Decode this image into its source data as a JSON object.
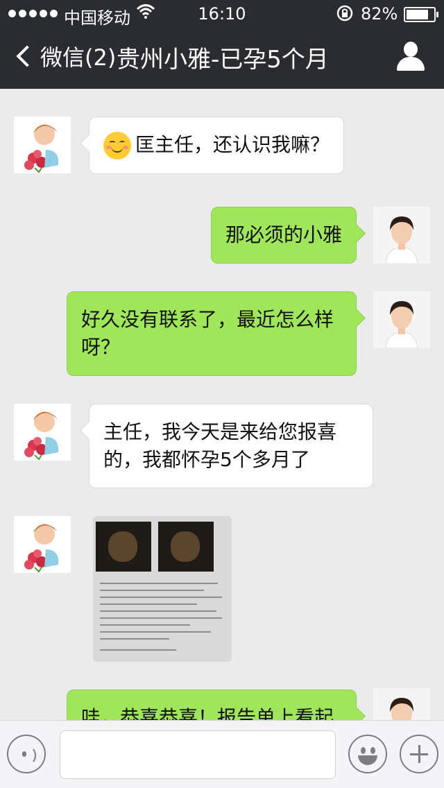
{
  "status_bar": {
    "carrier": "中国移动",
    "time": "16:10",
    "battery": "82%",
    "battery_level": 0.82,
    "wifi_icon": "wifi-icon",
    "lock_icon": "rotation-lock-icon"
  },
  "nav": {
    "back_label": "微信(2)",
    "title": "贵州小雅-已孕5个月",
    "profile_icon": "person-icon"
  },
  "messages": [
    {
      "side": "left",
      "sender": "xiaoya",
      "text": "匡主任，还认识我嘛？",
      "emoji": "smile-emoji"
    },
    {
      "side": "right",
      "sender": "doctor",
      "text": "那必须的小雅"
    },
    {
      "side": "right",
      "sender": "doctor",
      "text": "好久没有联系了，最近怎么样呀？"
    },
    {
      "side": "left",
      "sender": "xiaoya",
      "text": "主任，我今天是来给您报喜的，我都怀孕5个多月了"
    },
    {
      "side": "left",
      "sender": "xiaoya",
      "type": "image",
      "description_icon": "ultrasound-report-image"
    },
    {
      "side": "right",
      "sender": "doctor",
      "text": "哇，恭喜恭喜！报告单上看起"
    }
  ],
  "input_bar": {
    "voice_icon": "voice-icon",
    "emoji_icon": "emoji-icon",
    "plus_icon": "plus-icon",
    "text_value": ""
  },
  "colors": {
    "nav_bg": "#2b2c30",
    "chat_bg": "#ebebeb",
    "sent_bubble": "#9fe65b",
    "received_bubble": "#ffffff"
  }
}
